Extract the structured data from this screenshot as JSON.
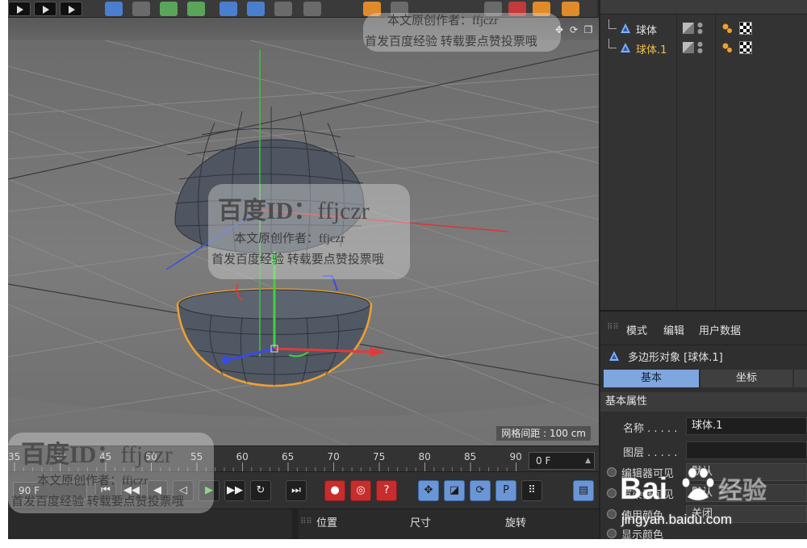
{
  "viewport": {
    "grid_readout": "网格间距 : 100 cm"
  },
  "timeline": {
    "ticks": [
      "35",
      "40",
      "45",
      "50",
      "55",
      "60",
      "65",
      "70",
      "75",
      "80",
      "85",
      "90"
    ],
    "end_frame": "0 F"
  },
  "transport": {
    "current_frame": "90 F"
  },
  "coords": {
    "headers": [
      "位置",
      "尺寸",
      "旋转"
    ]
  },
  "object_manager": {
    "objects": [
      {
        "name": "球体",
        "selected": false
      },
      {
        "name": "球体.1",
        "selected": true
      }
    ]
  },
  "attribute_manager": {
    "menu": [
      "模式",
      "编辑",
      "用户数据"
    ],
    "object_line": "多边形对象 [球体.1]",
    "tabs": [
      "基本",
      "坐标"
    ],
    "section": "基本属性",
    "fields": [
      {
        "label": "名称 . . . . .",
        "value": "球体.1"
      },
      {
        "label": "图层 . . . . .",
        "value": ""
      }
    ],
    "radios": [
      {
        "label": "编辑器可见",
        "value": "默认"
      },
      {
        "label": "渲染器可见",
        "value": "默认"
      },
      {
        "label": "使用颜色",
        "value": "关闭"
      },
      {
        "label": "显示颜色",
        "value": ""
      }
    ]
  },
  "watermark": {
    "id_label": "百度ID：",
    "id_value": "ffjczr",
    "author_line": "本文原创作者：ffjczr",
    "notice_line": "首发百度经验 转载要点赞投票哦",
    "baidu_text": "Bai",
    "baidu_jingyan": "经验",
    "baidu_url": "jingyan.baidu.com"
  },
  "colors": {
    "accent_blue": "#7fa6de",
    "selection_orange": "#f0a030",
    "selected_name": "#f0c04a"
  }
}
